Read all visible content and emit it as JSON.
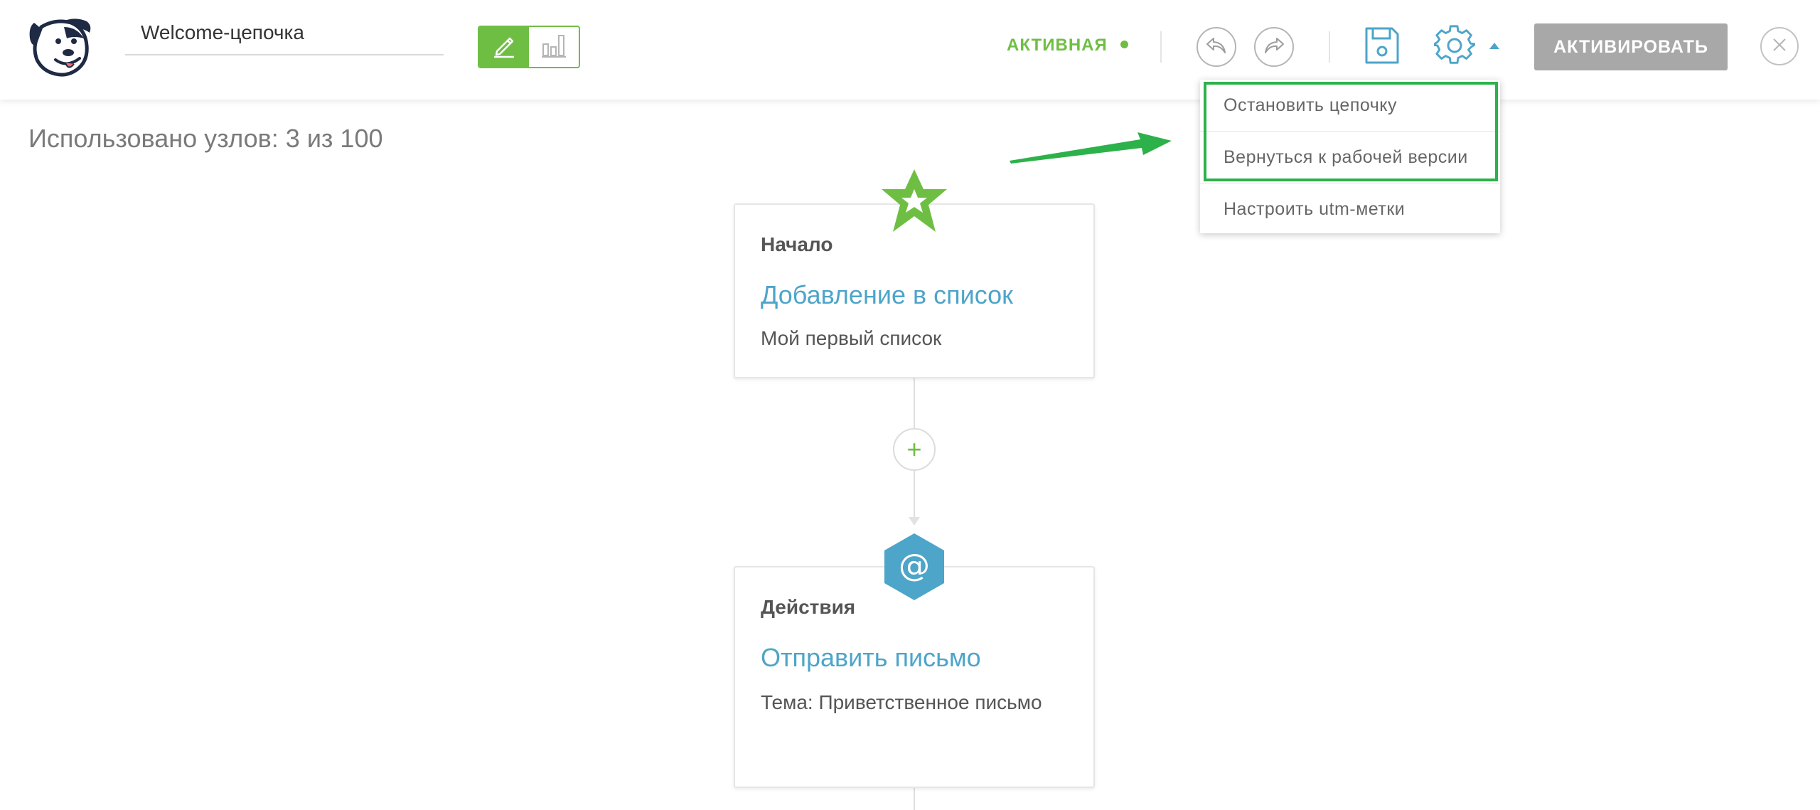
{
  "app": {
    "chain_name": "Welcome-цепочка",
    "status": "АКТИВНАЯ",
    "activate_label": "АКТИВИРОВАТЬ",
    "accent_color": "#6fbe44",
    "link_color": "#4da5c9"
  },
  "icons": {
    "logo": "dog-logo-icon",
    "edit": "pencil-icon",
    "stats": "bar-chart-icon",
    "undo": "undo-icon",
    "redo": "redo-icon",
    "save": "save-icon",
    "settings": "gear-icon",
    "caret": "caret-up-icon",
    "close": "close-icon"
  },
  "usage": {
    "text": "Использовано узлов: 3 из 100"
  },
  "dropdown": {
    "items": [
      {
        "label": "Остановить цепочку"
      },
      {
        "label": "Вернуться к рабочей версии"
      },
      {
        "label": "Настроить utm-метки"
      }
    ]
  },
  "nodes": [
    {
      "type_label": "Начало",
      "title": "Добавление в список",
      "subtitle": "Мой первый список"
    },
    {
      "type_label": "Действия",
      "title": "Отправить письмо",
      "subtitle": "Тема: Приветственное письмо"
    }
  ]
}
